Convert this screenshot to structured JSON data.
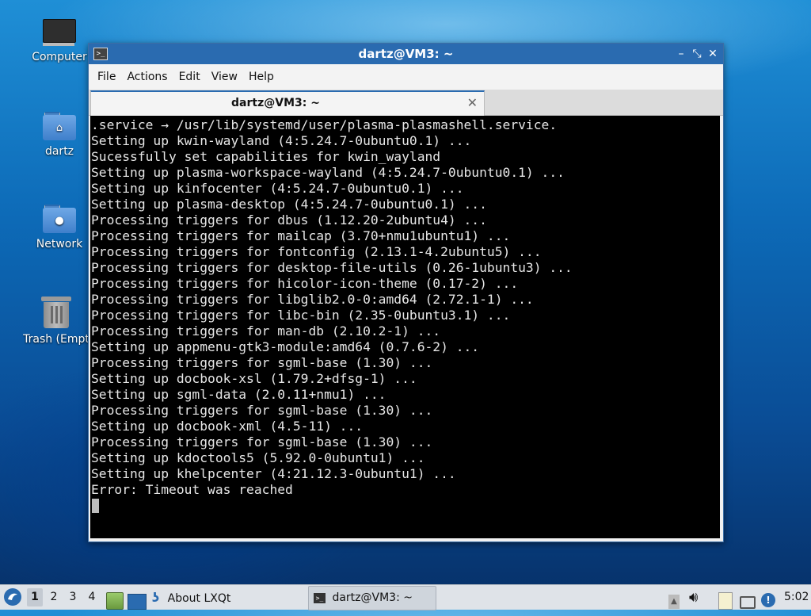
{
  "desktop": {
    "icons": [
      {
        "label": "Computer",
        "icon": "computer-icon"
      },
      {
        "label": "dartz",
        "icon": "home-folder-icon"
      },
      {
        "label": "Network",
        "icon": "network-folder-icon"
      },
      {
        "label": "Trash (Empt",
        "icon": "trash-icon"
      }
    ]
  },
  "window": {
    "title": "dartz@VM3: ~",
    "menu": [
      "File",
      "Actions",
      "Edit",
      "View",
      "Help"
    ],
    "tab_label": "dartz@VM3: ~",
    "buttons": {
      "minimize": "minimize-icon",
      "maximize": "maximize-icon",
      "close": "close-icon"
    }
  },
  "terminal": {
    "lines": [
      ".service → /usr/lib/systemd/user/plasma-plasmashell.service.",
      "Setting up kwin-wayland (4:5.24.7-0ubuntu0.1) ...",
      "Sucessfully set capabilities for kwin_wayland",
      "Setting up plasma-workspace-wayland (4:5.24.7-0ubuntu0.1) ...",
      "Setting up kinfocenter (4:5.24.7-0ubuntu0.1) ...",
      "Setting up plasma-desktop (4:5.24.7-0ubuntu0.1) ...",
      "Processing triggers for dbus (1.12.20-2ubuntu4) ...",
      "Processing triggers for mailcap (3.70+nmu1ubuntu1) ...",
      "Processing triggers for fontconfig (2.13.1-4.2ubuntu5) ...",
      "Processing triggers for desktop-file-utils (0.26-1ubuntu3) ...",
      "Processing triggers for hicolor-icon-theme (0.17-2) ...",
      "Processing triggers for libglib2.0-0:amd64 (2.72.1-1) ...",
      "Processing triggers for libc-bin (2.35-0ubuntu3.1) ...",
      "Processing triggers for man-db (2.10.2-1) ...",
      "Setting up appmenu-gtk3-module:amd64 (0.7.6-2) ...",
      "Processing triggers for sgml-base (1.30) ...",
      "Setting up docbook-xsl (1.79.2+dfsg-1) ...",
      "Setting up sgml-data (2.0.11+nmu1) ...",
      "Processing triggers for sgml-base (1.30) ...",
      "Setting up docbook-xml (4.5-11) ...",
      "Processing triggers for sgml-base (1.30) ...",
      "Setting up kdoctools5 (5.92.0-0ubuntu1) ...",
      "Setting up khelpcenter (4:21.12.3-0ubuntu1) ...",
      "Error: Timeout was reached"
    ]
  },
  "taskbar": {
    "desktops": [
      "1",
      "2",
      "3",
      "4"
    ],
    "active_desktop": "1",
    "launcher_label": "About LXQt",
    "task_label": "dartz@VM3: ~",
    "clock": "5:02"
  }
}
